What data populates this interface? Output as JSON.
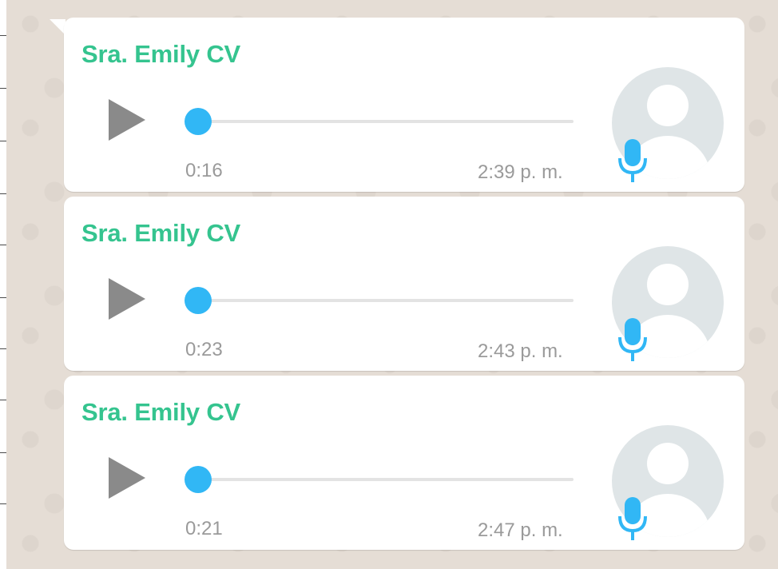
{
  "colors": {
    "sender_name": "#35c48f",
    "progress_knob": "#31b7f5",
    "play_icon": "#8a8a8a",
    "meta_text": "#9a9a9a",
    "chat_background": "#e5ddd5",
    "bubble": "#ffffff"
  },
  "messages": [
    {
      "sender": "Sra. Emily CV",
      "duration": "0:16",
      "time": "2:39 p. m.",
      "progress": 0,
      "play_icon": "play-icon",
      "avatar_icon": "default-avatar-icon",
      "badge_icon": "microphone-icon"
    },
    {
      "sender": "Sra. Emily CV",
      "duration": "0:23",
      "time": "2:43 p. m.",
      "progress": 0,
      "play_icon": "play-icon",
      "avatar_icon": "default-avatar-icon",
      "badge_icon": "microphone-icon"
    },
    {
      "sender": "Sra. Emily CV",
      "duration": "0:21",
      "time": "2:47 p. m.",
      "progress": 0,
      "play_icon": "play-icon",
      "avatar_icon": "default-avatar-icon",
      "badge_icon": "microphone-icon"
    }
  ]
}
